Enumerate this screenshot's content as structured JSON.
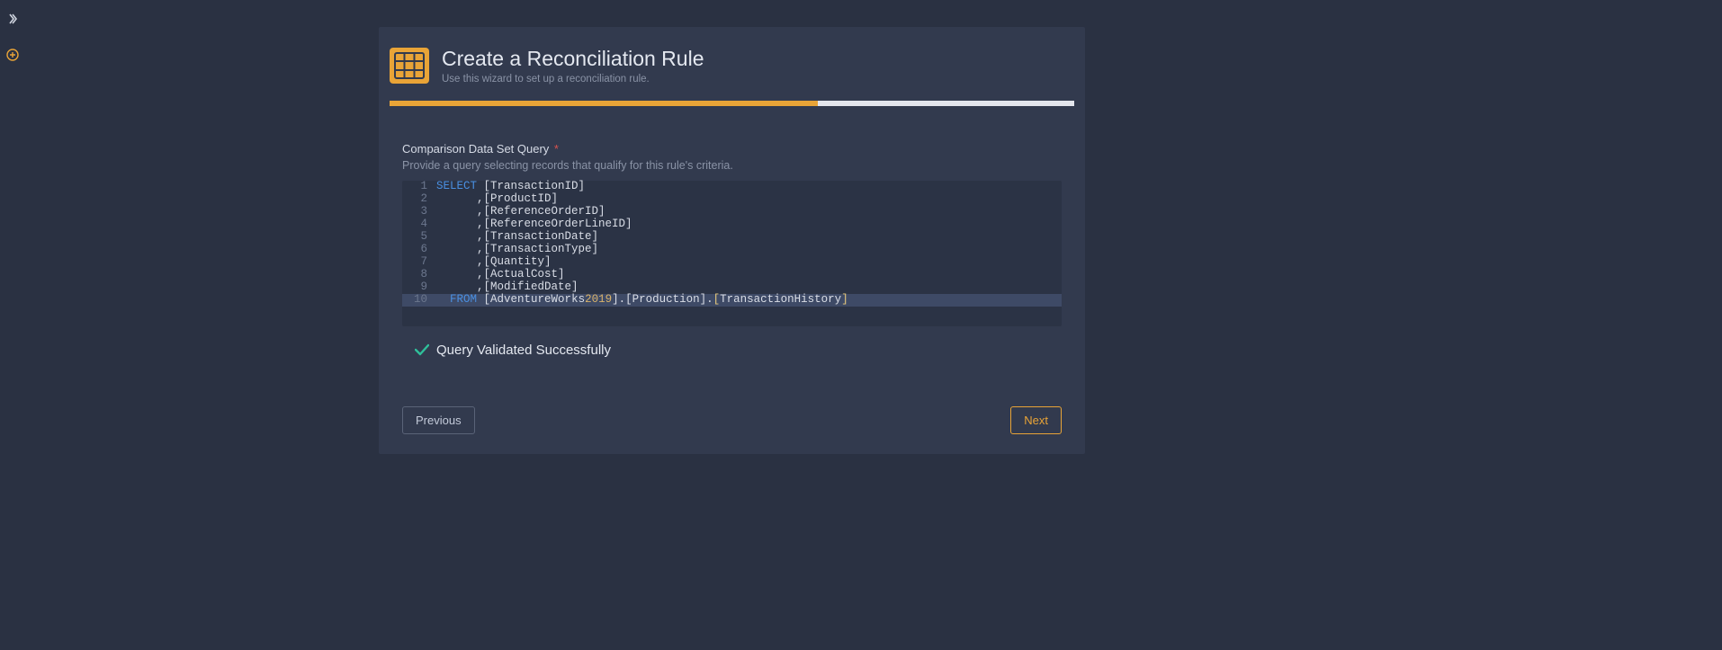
{
  "sidebar": {
    "expand_icon": "chevron-right",
    "add_icon": "plus-circle"
  },
  "wizard": {
    "title": "Create a Reconciliation Rule",
    "subtitle": "Use this wizard to set up a reconciliation rule.",
    "progress_percent": 62.5,
    "field_label": "Comparison Data Set Query",
    "required": "*",
    "field_help": "Provide a query selecting records that qualify for this rule's criteria.",
    "validation_message": "Query Validated Successfully",
    "prev_label": "Previous",
    "next_label": "Next"
  },
  "code": {
    "lines": [
      {
        "n": 1,
        "highlighted": false,
        "tokens": [
          {
            "t": "SELECT",
            "c": "kw"
          },
          {
            "t": " ",
            "c": "sp"
          },
          {
            "t": "[TransactionID]",
            "c": "ident"
          }
        ]
      },
      {
        "n": 2,
        "highlighted": false,
        "tokens": [
          {
            "t": "      ,",
            "c": "punc"
          },
          {
            "t": "[ProductID]",
            "c": "ident"
          }
        ]
      },
      {
        "n": 3,
        "highlighted": false,
        "tokens": [
          {
            "t": "      ,",
            "c": "punc"
          },
          {
            "t": "[ReferenceOrderID]",
            "c": "ident"
          }
        ]
      },
      {
        "n": 4,
        "highlighted": false,
        "tokens": [
          {
            "t": "      ,",
            "c": "punc"
          },
          {
            "t": "[ReferenceOrderLineID]",
            "c": "ident"
          }
        ]
      },
      {
        "n": 5,
        "highlighted": false,
        "tokens": [
          {
            "t": "      ,",
            "c": "punc"
          },
          {
            "t": "[TransactionDate]",
            "c": "ident"
          }
        ]
      },
      {
        "n": 6,
        "highlighted": false,
        "tokens": [
          {
            "t": "      ,",
            "c": "punc"
          },
          {
            "t": "[TransactionType]",
            "c": "ident"
          }
        ]
      },
      {
        "n": 7,
        "highlighted": false,
        "tokens": [
          {
            "t": "      ,",
            "c": "punc"
          },
          {
            "t": "[Quantity]",
            "c": "ident"
          }
        ]
      },
      {
        "n": 8,
        "highlighted": false,
        "tokens": [
          {
            "t": "      ,",
            "c": "punc"
          },
          {
            "t": "[ActualCost]",
            "c": "ident"
          }
        ]
      },
      {
        "n": 9,
        "highlighted": false,
        "tokens": [
          {
            "t": "      ,",
            "c": "punc"
          },
          {
            "t": "[ModifiedDate]",
            "c": "ident"
          }
        ]
      },
      {
        "n": 10,
        "highlighted": true,
        "tokens": [
          {
            "t": "  ",
            "c": "sp"
          },
          {
            "t": "FROM",
            "c": "kw"
          },
          {
            "t": " ",
            "c": "sp"
          },
          {
            "t": "[AdventureWorks",
            "c": "ident"
          },
          {
            "t": "2019",
            "c": "num"
          },
          {
            "t": "].[Production]",
            "c": "ident"
          },
          {
            "t": ".",
            "c": "punc"
          },
          {
            "t": "[",
            "c": "bracket-b"
          },
          {
            "t": "TransactionHistory",
            "c": "ident"
          },
          {
            "t": "]",
            "c": "bracket-b"
          }
        ]
      }
    ]
  }
}
